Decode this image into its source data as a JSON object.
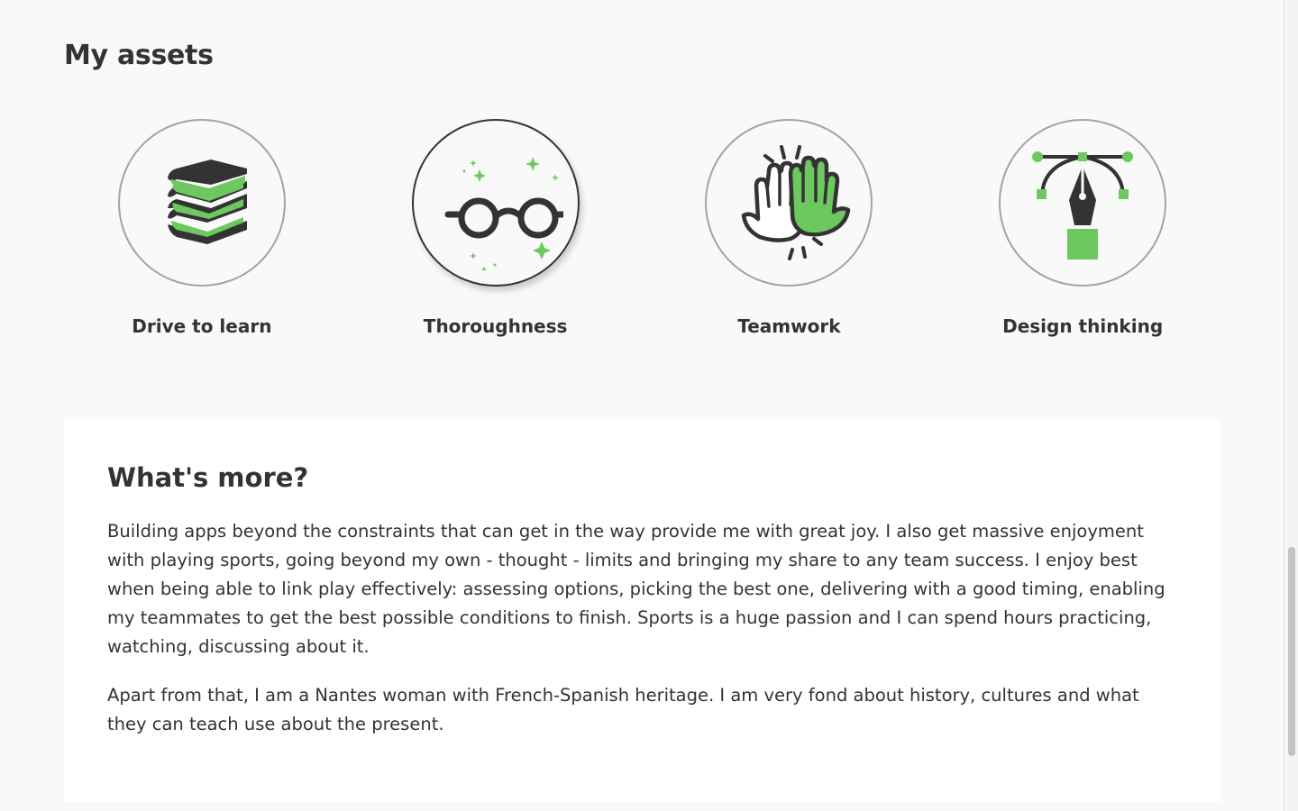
{
  "assets_section": {
    "title": "My assets",
    "items": [
      {
        "label": "Drive to learn",
        "icon": "books-icon"
      },
      {
        "label": "Thoroughness",
        "icon": "glasses-icon"
      },
      {
        "label": "Teamwork",
        "icon": "high-five-icon"
      },
      {
        "label": "Design thinking",
        "icon": "pen-tool-icon"
      }
    ]
  },
  "more_section": {
    "title": "What's more?",
    "paragraphs": [
      "Building apps beyond the constraints that can get in the way provide me with great joy. I also get massive enjoyment with playing sports, going beyond my own - thought - limits and bringing my share to any team success. I enjoy best when being able to link play effectively: assessing options, picking the best one, delivering with a good timing, enabling my teammates to get the best possible conditions to finish. Sports is a huge passion and I can spend hours practicing, watching, discussing about it.",
      "Apart from that, I am a Nantes woman with French-Spanish heritage. I am very fond about history, cultures and what they can teach use about the present."
    ]
  },
  "colors": {
    "accent_green": "#6cc85f",
    "text_dark": "#333333",
    "background": "#f9f9f9"
  }
}
